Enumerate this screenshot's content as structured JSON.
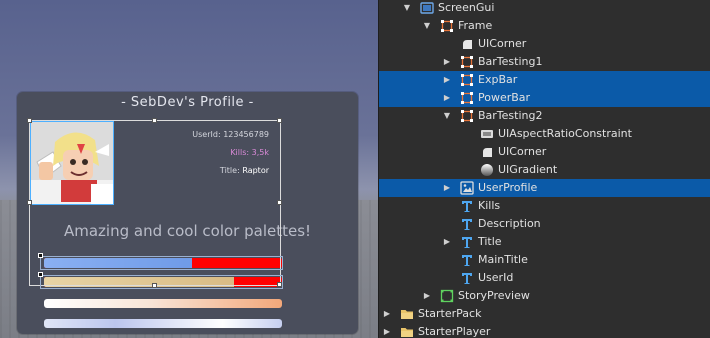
{
  "viewport": {
    "profile": {
      "title": "- SebDev's Profile -",
      "userid_text": "UserId: 123456789",
      "kills_text": "Kills: 3,5k",
      "title_label": "Title: ",
      "title_value": "Raptor",
      "description": "Amazing and cool color palettes!",
      "exp_fill": 0.62,
      "power_fill": 0.8
    }
  },
  "explorer": {
    "rows": [
      {
        "label": "ScreenGui",
        "icon": "screengui-icon",
        "arrow": "down",
        "selected": false
      },
      {
        "label": "Frame",
        "icon": "frame-icon",
        "arrow": "down",
        "selected": false
      },
      {
        "label": "UICorner",
        "icon": "uicorner-icon",
        "arrow": "none",
        "selected": false
      },
      {
        "label": "BarTesting1",
        "icon": "frame-icon",
        "arrow": "right",
        "selected": false
      },
      {
        "label": "ExpBar",
        "icon": "frame-icon",
        "arrow": "right",
        "selected": true
      },
      {
        "label": "PowerBar",
        "icon": "frame-icon",
        "arrow": "right",
        "selected": true
      },
      {
        "label": "BarTesting2",
        "icon": "frame-icon",
        "arrow": "down",
        "selected": false
      },
      {
        "label": "UIAspectRatioConstraint",
        "icon": "aspect-ratio-icon",
        "arrow": "none",
        "selected": false
      },
      {
        "label": "UICorner",
        "icon": "uicorner-icon",
        "arrow": "none",
        "selected": false
      },
      {
        "label": "UIGradient",
        "icon": "gradient-icon",
        "arrow": "none",
        "selected": false
      },
      {
        "label": "UserProfile",
        "icon": "imagelabel-icon",
        "arrow": "right",
        "selected": true
      },
      {
        "label": "Kills",
        "icon": "textlabel-icon",
        "arrow": "none",
        "selected": false
      },
      {
        "label": "Description",
        "icon": "textlabel-icon",
        "arrow": "none",
        "selected": false
      },
      {
        "label": "Title",
        "icon": "textlabel-icon",
        "arrow": "right",
        "selected": false
      },
      {
        "label": "MainTitle",
        "icon": "textlabel-icon",
        "arrow": "none",
        "selected": false
      },
      {
        "label": "UserId",
        "icon": "textlabel-icon",
        "arrow": "none",
        "selected": false
      },
      {
        "label": "StoryPreview",
        "icon": "storypreview-icon",
        "arrow": "right",
        "selected": false
      },
      {
        "label": "StarterPack",
        "icon": "folder-icon",
        "arrow": "right",
        "selected": false
      },
      {
        "label": "StarterPlayer",
        "icon": "folder-icon",
        "arrow": "right",
        "selected": false
      }
    ]
  },
  "colors": {
    "selection": "#0b5aa8",
    "frame_icon": "#e8753a",
    "textlabel_icon": "#4ea6f0",
    "storypreview_icon": "#5fd15f",
    "kills_text": "#d98ad7",
    "bar_background": "#ff0000"
  }
}
